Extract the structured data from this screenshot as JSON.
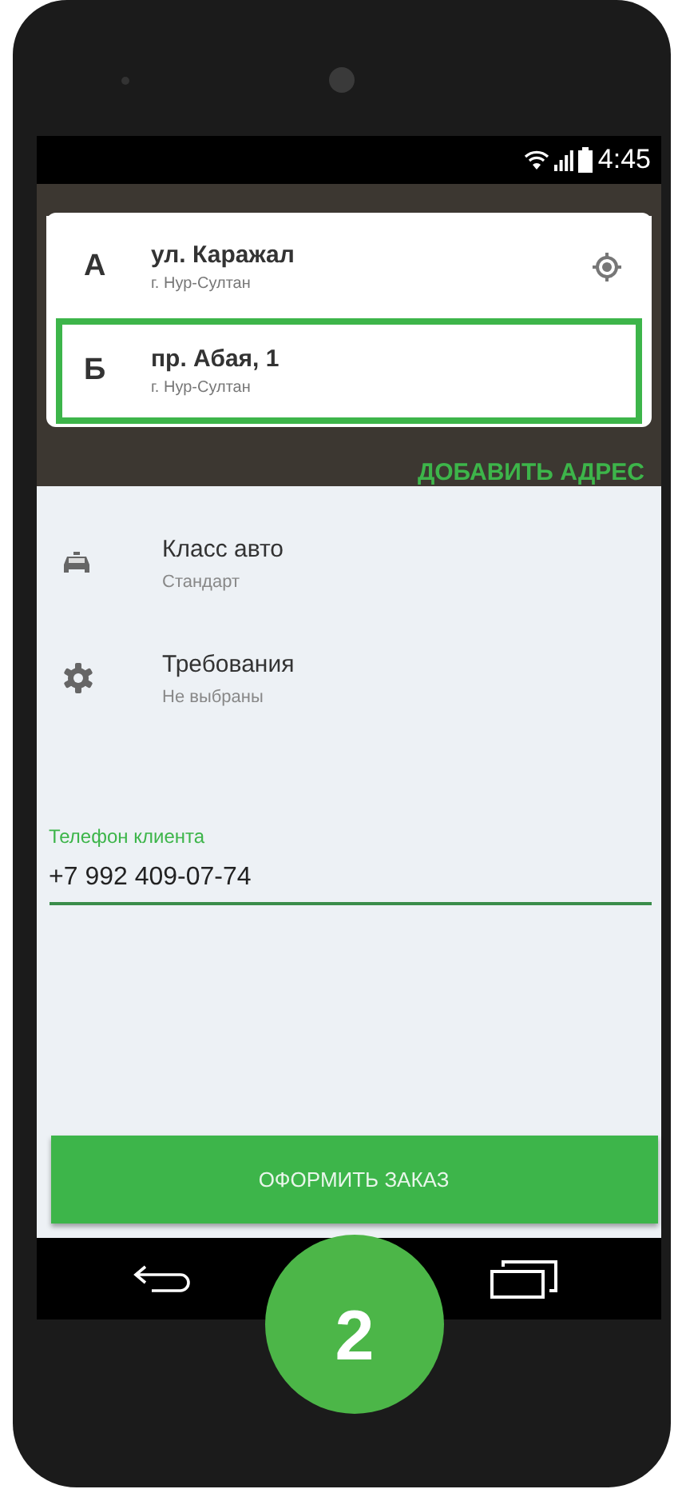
{
  "status_bar": {
    "time": "4:45"
  },
  "addresses": [
    {
      "kind": "origin",
      "letter": "А",
      "street": "ул. Каражал",
      "city": "г. Нур-Султан",
      "selected": false
    },
    {
      "kind": "destination",
      "letter": "Б",
      "street": "пр. Абая, 1",
      "city": "г. Нур-Султан",
      "selected": true
    }
  ],
  "add_address": "ДОБАВИТЬ АДРЕС",
  "options": [
    {
      "kind": "car",
      "title": "Класс авто",
      "value": "Стандарт"
    },
    {
      "kind": "gear",
      "title": "Требования",
      "value": "Не выбраны"
    }
  ],
  "phone_field": {
    "label": "Телефон клиента",
    "value": "+7 992 409-07-74"
  },
  "order_button": "ОФОРМИТЬ ЗАКАЗ",
  "step_badge": "2"
}
